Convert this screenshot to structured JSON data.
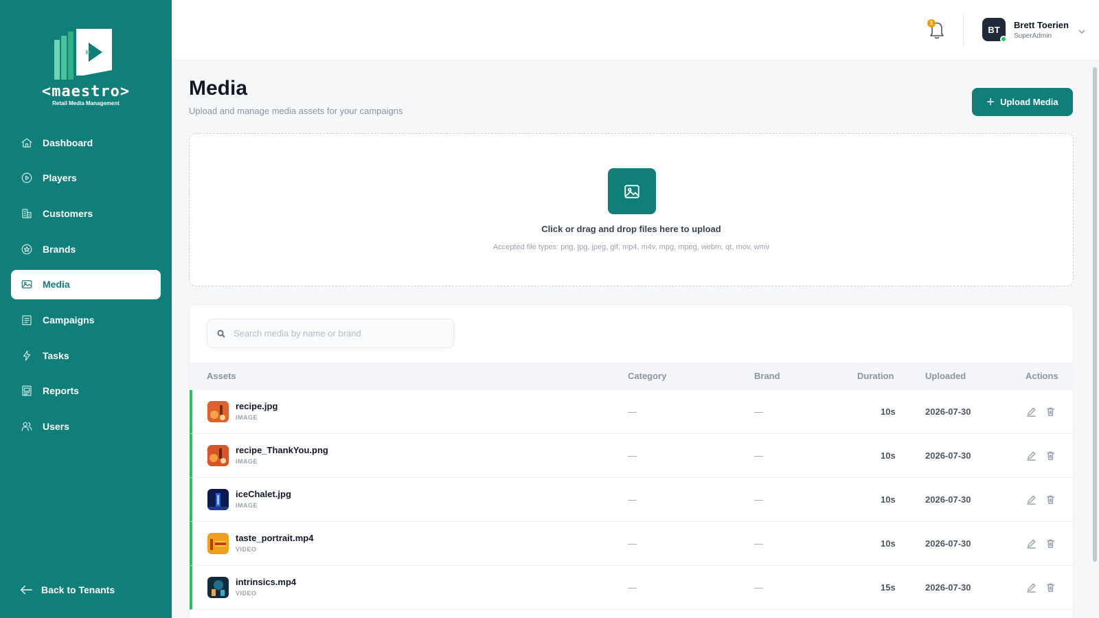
{
  "brand": {
    "wordmark": "<maestro>",
    "tagline": "Retail Media Management",
    "accent_color": "#107f7a",
    "status_color": "#22c55e"
  },
  "sidebar": {
    "items": [
      {
        "label": "Dashboard",
        "icon": "home-icon"
      },
      {
        "label": "Players",
        "icon": "play-circle-icon"
      },
      {
        "label": "Customers",
        "icon": "building-icon"
      },
      {
        "label": "Brands",
        "icon": "star-badge-icon"
      },
      {
        "label": "Media",
        "icon": "image-icon",
        "active": true
      },
      {
        "label": "Campaigns",
        "icon": "clipboard-icon"
      },
      {
        "label": "Tasks",
        "icon": "lightning-icon"
      },
      {
        "label": "Reports",
        "icon": "report-icon"
      },
      {
        "label": "Users",
        "icon": "users-icon"
      }
    ],
    "back_label": "Back to Tenants"
  },
  "header": {
    "notification_count": "1",
    "user": {
      "initials": "BT",
      "name": "Brett Toerien",
      "role": "SuperAdmin"
    }
  },
  "page": {
    "title": "Media",
    "subtitle": "Upload and manage media assets for your campaigns",
    "upload_button": "Upload Media"
  },
  "dropzone": {
    "title": "Click or drag and drop files here to upload",
    "accepted": "Accepted file types: png, jpg, jpeg, gif, mp4, m4v, mpg, mpeg, webm, qt, mov, wmv"
  },
  "search": {
    "placeholder": "Search media by name or brand",
    "value": ""
  },
  "table": {
    "columns": {
      "assets": "Assets",
      "category": "Category",
      "brand": "Brand",
      "duration": "Duration",
      "uploaded": "Uploaded",
      "actions": "Actions"
    },
    "rows": [
      {
        "name": "recipe.jpg",
        "type": "IMAGE",
        "category": "—",
        "brand": "—",
        "duration": "10s",
        "uploaded": "2026-07-30"
      },
      {
        "name": "recipe_ThankYou.png",
        "type": "IMAGE",
        "category": "—",
        "brand": "—",
        "duration": "10s",
        "uploaded": "2026-07-30"
      },
      {
        "name": "iceChalet.jpg",
        "type": "IMAGE",
        "category": "—",
        "brand": "—",
        "duration": "10s",
        "uploaded": "2026-07-30"
      },
      {
        "name": "taste_portrait.mp4",
        "type": "VIDEO",
        "category": "—",
        "brand": "—",
        "duration": "10s",
        "uploaded": "2026-07-30"
      },
      {
        "name": "intrinsics.mp4",
        "type": "VIDEO",
        "category": "—",
        "brand": "—",
        "duration": "15s",
        "uploaded": "2026-07-30"
      }
    ]
  }
}
